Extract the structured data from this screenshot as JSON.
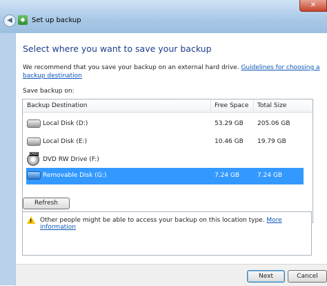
{
  "window": {
    "title": "Set up backup",
    "close": "✕",
    "back": "◀"
  },
  "heading": "Select where you want to save your backup",
  "description": {
    "text": "We recommend that you save your backup on an external hard drive. ",
    "link": "Guidelines for choosing a backup destination"
  },
  "save_label": "Save backup on:",
  "table": {
    "headers": {
      "destination": "Backup Destination",
      "free": "Free Space",
      "total": "Total Size"
    },
    "rows": [
      {
        "name": "Local Disk (D:)",
        "free": "53.29 GB",
        "total": "205.06 GB",
        "icon": "hard-drive-icon"
      },
      {
        "name": "Local Disk (E:)",
        "free": "10.46 GB",
        "total": "19.79 GB",
        "icon": "hard-drive-icon"
      },
      {
        "name": "DVD RW Drive (F:)",
        "free": "",
        "total": "",
        "icon": "dvd-drive-icon"
      },
      {
        "name": "Removable Disk (G:)",
        "free": "7.24 GB",
        "total": "7.24 GB",
        "icon": "removable-disk-icon",
        "selected": true
      }
    ]
  },
  "refresh_label": "Refresh",
  "warning": {
    "text": "Other people might be able to access your backup on this location type. ",
    "link": "More information"
  },
  "footer": {
    "next": "Next",
    "cancel": "Cancel"
  },
  "colors": {
    "accent": "#1a3e8c",
    "selection": "#3399ff",
    "link": "#0a57b5"
  }
}
